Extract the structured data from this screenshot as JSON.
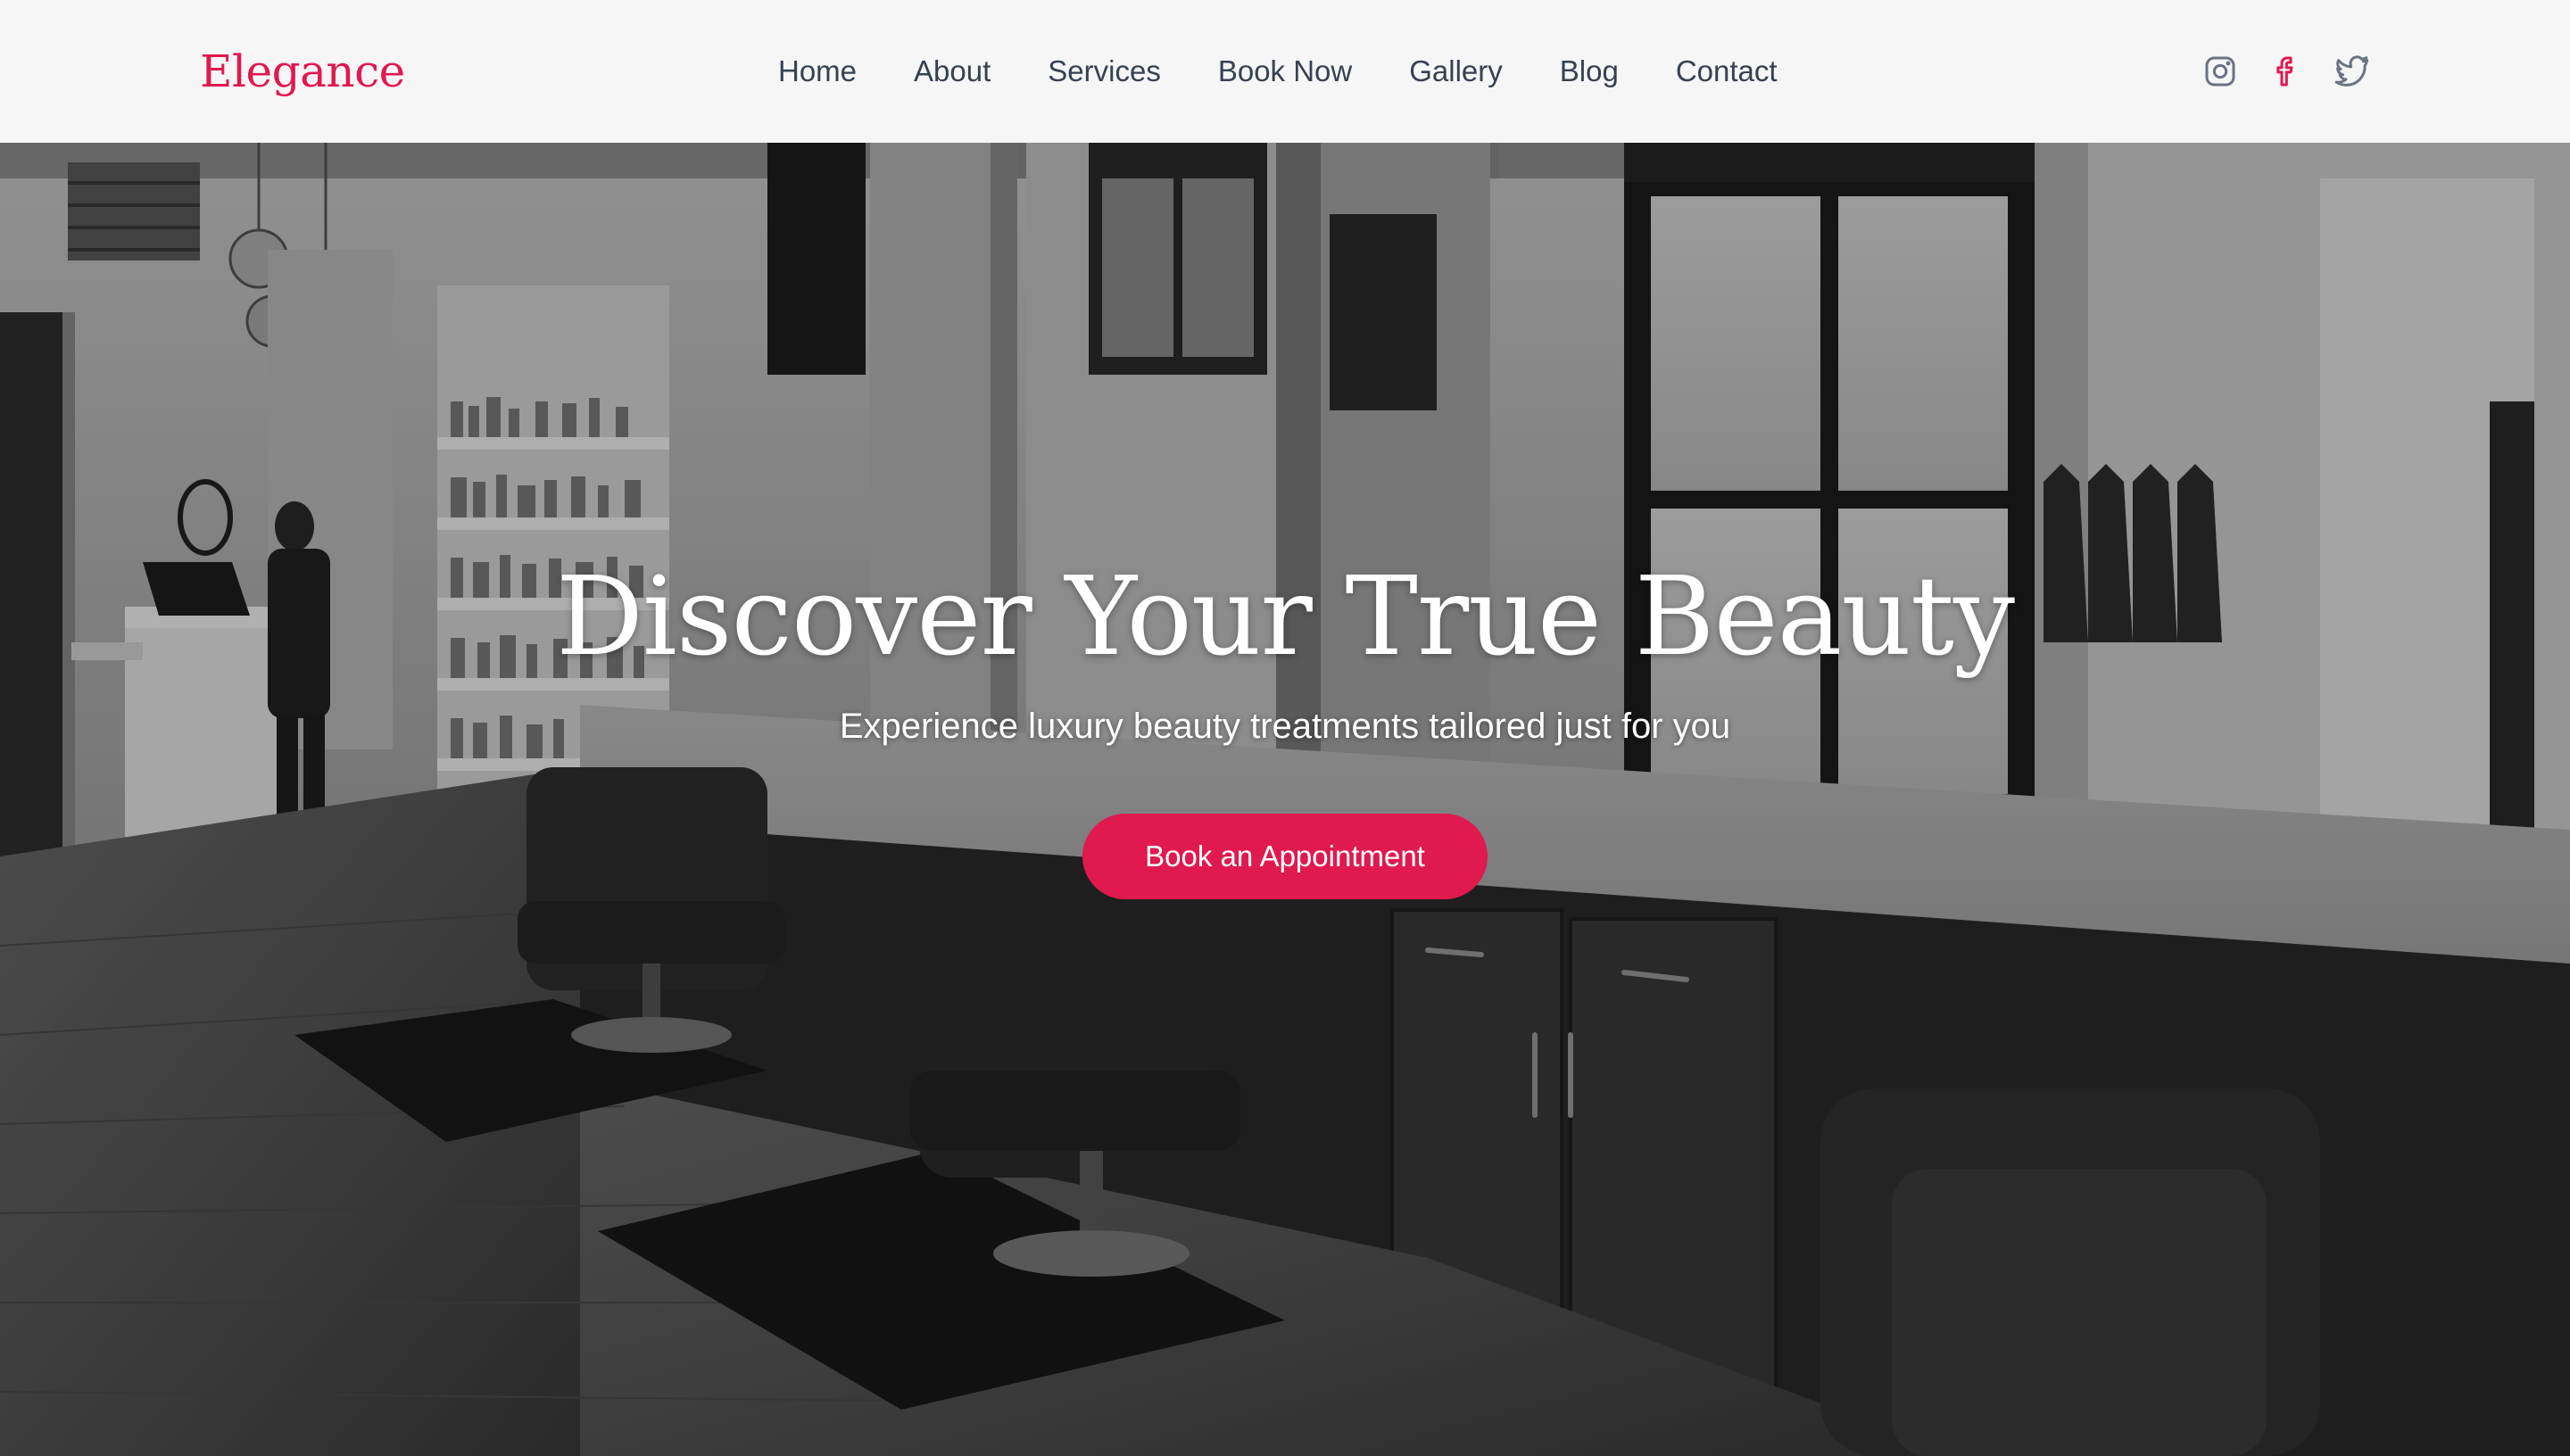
{
  "brand": {
    "name": "Elegance",
    "accent_color": "#e0194f"
  },
  "nav": {
    "items": [
      {
        "label": "Home"
      },
      {
        "label": "About"
      },
      {
        "label": "Services"
      },
      {
        "label": "Book Now"
      },
      {
        "label": "Gallery"
      },
      {
        "label": "Blog"
      },
      {
        "label": "Contact"
      }
    ]
  },
  "social": {
    "icons": [
      "instagram-icon",
      "facebook-icon",
      "twitter-icon"
    ]
  },
  "hero": {
    "title": "Discover Your True Beauty",
    "subtitle": "Experience luxury beauty treatments tailored just for you",
    "cta_label": "Book an Appointment",
    "background": "black-and-white salon interior photo"
  }
}
